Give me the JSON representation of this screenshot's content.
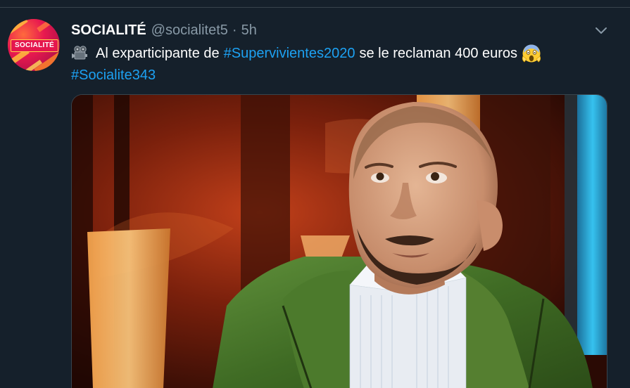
{
  "tweet": {
    "display_name": "SOCIALITÉ",
    "handle": "@socialitet5",
    "separator": "·",
    "time": "5h",
    "avatar_text": "SOCIALITÉ",
    "text_before": "Al exparticipante de",
    "hashtag_1": "#Supervivientes2020",
    "text_after": "se le reclaman 400 euros",
    "hashtag_2": "#Socialite343",
    "leading_emoji": "movie-camera-icon",
    "trailing_emoji": "face-screaming-in-fear-icon",
    "media_description_icon": "tweet-photo"
  },
  "colors": {
    "background": "#15202b",
    "text": "#ffffff",
    "secondary_text": "#8899a6",
    "link": "#1da1f2",
    "border": "#38444d"
  }
}
